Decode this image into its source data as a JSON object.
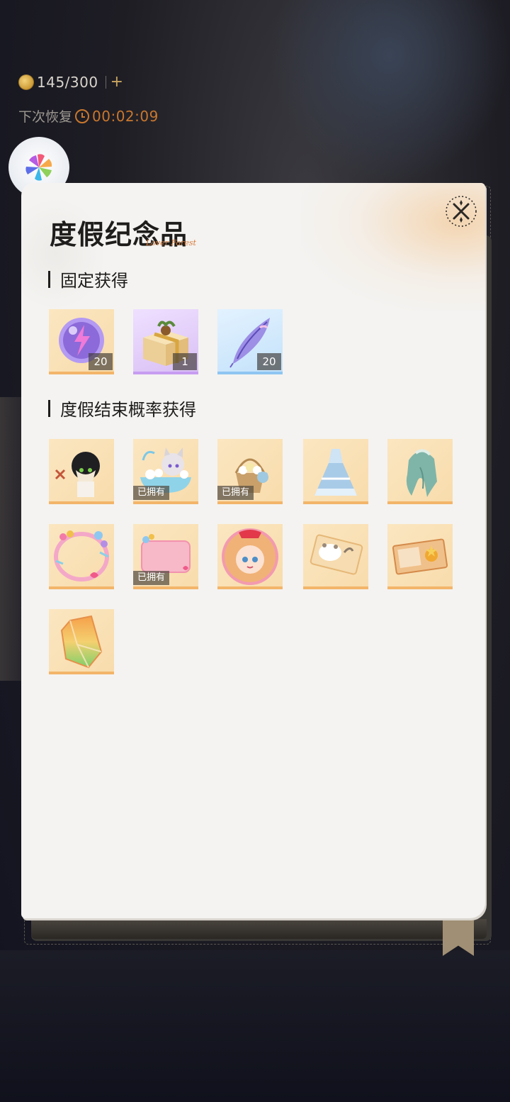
{
  "hud": {
    "stamina": "145/300",
    "recover_label": "下次恢复",
    "recover_time": "00:02:09"
  },
  "panel": {
    "title": "度假纪念品",
    "title_script": "Lover Forest",
    "sections": {
      "fixed": {
        "title": "固定获得",
        "items": [
          {
            "name": "energy-orb-icon",
            "quantity": "20"
          },
          {
            "name": "gift-box-icon",
            "quantity": "1"
          },
          {
            "name": "feather-icon",
            "quantity": "20"
          }
        ]
      },
      "chance": {
        "title": "度假结束概率获得",
        "items": [
          {
            "name": "black-cat-chibi-icon",
            "status": ""
          },
          {
            "name": "bath-chibi-icon",
            "status": "已拥有"
          },
          {
            "name": "flower-basket-icon",
            "status": "已拥有"
          },
          {
            "name": "blue-dress-icon",
            "status": ""
          },
          {
            "name": "braided-hair-icon",
            "status": ""
          },
          {
            "name": "bubble-frame-icon",
            "status": ""
          },
          {
            "name": "pink-chat-bubble-icon",
            "status": "已拥有"
          },
          {
            "name": "girl-avatar-icon",
            "status": ""
          },
          {
            "name": "cat-card-icon",
            "status": ""
          },
          {
            "name": "photo-card-icon",
            "status": ""
          },
          {
            "name": "rainbow-crystal-icon",
            "status": ""
          }
        ]
      }
    }
  },
  "colors": {
    "accent_orange": "#c9772d",
    "panel_bg": "#f4f3f1",
    "item_border": "#f3b56a"
  }
}
